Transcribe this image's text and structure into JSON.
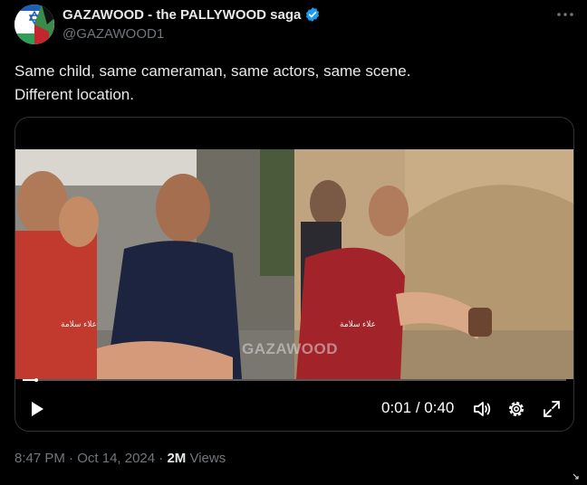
{
  "author": {
    "display_name": "GAZAWOOD - the PALLYWOOD saga",
    "handle": "@GAZAWOOD1"
  },
  "tweet": {
    "lines": [
      "Same child, same cameraman, same actors, same scene.",
      "Different location."
    ]
  },
  "video": {
    "watermark": "GAZAWOOD",
    "caption_left": "علاء سلامة",
    "caption_right": "علاء سلامة",
    "current_time": "0:01",
    "separator": "/",
    "duration": "0:40",
    "progress_fraction": 0.025
  },
  "meta": {
    "time": "8:47 PM",
    "dot1": "·",
    "date": "Oct 14, 2024",
    "dot2": "·",
    "views_count": "2M",
    "views_label": "Views"
  },
  "icons": {
    "verified": "verified-badge-icon",
    "more": "more-icon",
    "play": "play-icon",
    "volume": "volume-icon",
    "settings": "gear-icon",
    "fullscreen": "fullscreen-icon"
  },
  "colors": {
    "background": "#000000",
    "text": "#e7e9ea",
    "muted": "#71767b",
    "verified": "#1d9bf0"
  }
}
